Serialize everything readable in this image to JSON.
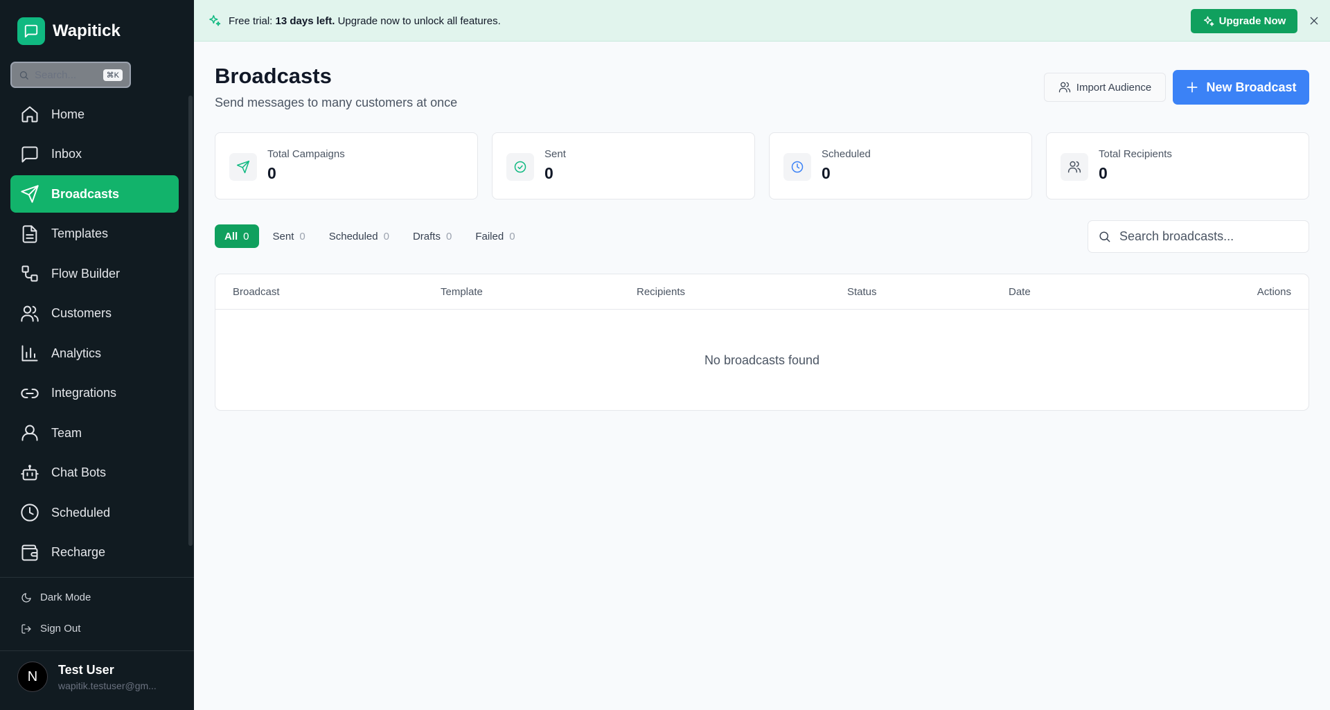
{
  "app": {
    "name": "Wapitick"
  },
  "sidebar": {
    "search_placeholder": "Search...",
    "search_shortcut": "⌘K",
    "items": [
      {
        "label": "Home",
        "icon": "home-icon",
        "active": false
      },
      {
        "label": "Inbox",
        "icon": "inbox-icon",
        "active": false
      },
      {
        "label": "Broadcasts",
        "icon": "send-icon",
        "active": true
      },
      {
        "label": "Templates",
        "icon": "file-text-icon",
        "active": false
      },
      {
        "label": "Flow Builder",
        "icon": "workflow-icon",
        "active": false
      },
      {
        "label": "Customers",
        "icon": "users-icon",
        "active": false
      },
      {
        "label": "Analytics",
        "icon": "bar-chart-icon",
        "active": false
      },
      {
        "label": "Integrations",
        "icon": "link-icon",
        "active": false
      },
      {
        "label": "Team",
        "icon": "user-icon",
        "active": false
      },
      {
        "label": "Chat Bots",
        "icon": "bot-icon",
        "active": false
      },
      {
        "label": "Scheduled",
        "icon": "clock-icon",
        "active": false
      },
      {
        "label": "Recharge",
        "icon": "wallet-icon",
        "active": false
      }
    ],
    "dark_mode_label": "Dark Mode",
    "sign_out_label": "Sign Out",
    "user": {
      "initial": "N",
      "name": "Test User",
      "email": "wapitik.testuser@gm..."
    }
  },
  "banner": {
    "prefix": "Free trial:",
    "highlight": "13 days left.",
    "suffix": "Upgrade now to unlock all features.",
    "upgrade_label": "Upgrade Now"
  },
  "header": {
    "title": "Broadcasts",
    "subtitle": "Send messages to many customers at once",
    "import_label": "Import Audience",
    "new_label": "New Broadcast"
  },
  "stats": [
    {
      "label": "Total Campaigns",
      "value": "0",
      "icon": "send-icon",
      "color": "#10b981"
    },
    {
      "label": "Sent",
      "value": "0",
      "icon": "check-circle-icon",
      "color": "#10b981"
    },
    {
      "label": "Scheduled",
      "value": "0",
      "icon": "clock-icon",
      "color": "#3b82f6"
    },
    {
      "label": "Total Recipients",
      "value": "0",
      "icon": "users-icon",
      "color": "#4b5563"
    }
  ],
  "filters": {
    "tabs": [
      {
        "label": "All",
        "count": "0",
        "active": true
      },
      {
        "label": "Sent",
        "count": "0",
        "active": false
      },
      {
        "label": "Scheduled",
        "count": "0",
        "active": false
      },
      {
        "label": "Drafts",
        "count": "0",
        "active": false
      },
      {
        "label": "Failed",
        "count": "0",
        "active": false
      }
    ],
    "search_placeholder": "Search broadcasts..."
  },
  "table": {
    "columns": [
      "Broadcast",
      "Template",
      "Recipients",
      "Status",
      "Date",
      "Actions"
    ],
    "empty_message": "No broadcasts found"
  },
  "colors": {
    "sidebar_bg": "#111b21",
    "accent_green": "#10a05e",
    "accent_blue": "#3b82f6"
  }
}
